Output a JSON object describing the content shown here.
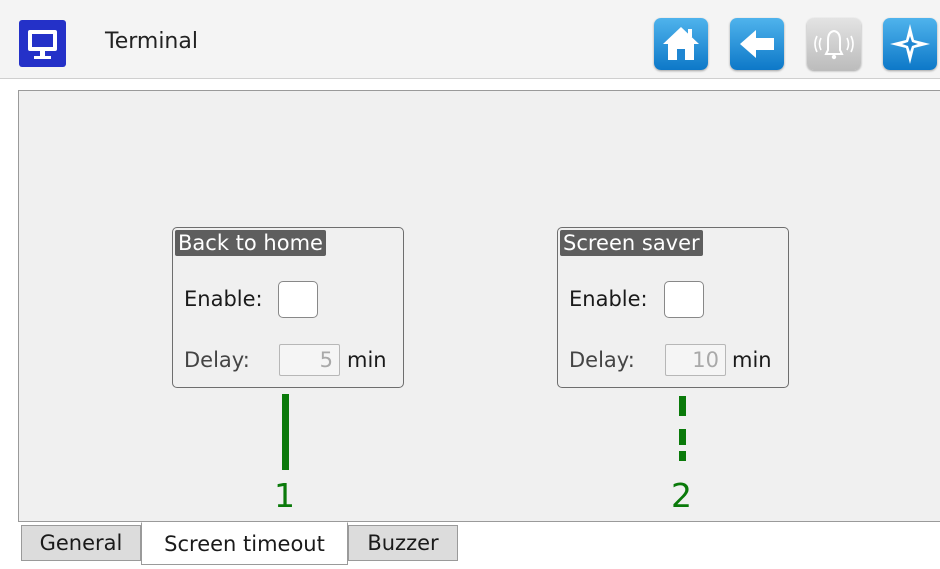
{
  "header": {
    "title": "Terminal",
    "app_icon": "monitor-icon",
    "buttons": [
      {
        "name": "home-icon",
        "enabled": true
      },
      {
        "name": "back-arrow-icon",
        "enabled": true
      },
      {
        "name": "bell-icon",
        "enabled": false
      },
      {
        "name": "compass-icon",
        "enabled": true
      }
    ],
    "accent": "#0d78c8"
  },
  "groups": {
    "back_to_home": {
      "title": "Back to home",
      "enable_label": "Enable:",
      "enabled": false,
      "delay_label": "Delay:",
      "delay_value": "5",
      "delay_unit": "min"
    },
    "screen_saver": {
      "title": "Screen saver",
      "enable_label": "Enable:",
      "enabled": false,
      "delay_label": "Delay:",
      "delay_value": "10",
      "delay_unit": "min"
    }
  },
  "annotations": {
    "marker_1": "1",
    "marker_2": "2",
    "color": "#0a7a0a"
  },
  "tabs": [
    {
      "label": "General",
      "active": false
    },
    {
      "label": "Screen timeout",
      "active": true
    },
    {
      "label": "Buzzer",
      "active": false
    }
  ]
}
